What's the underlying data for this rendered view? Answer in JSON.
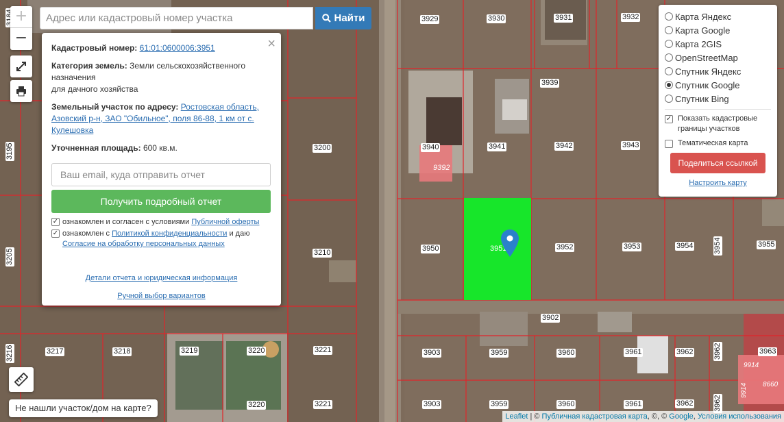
{
  "search": {
    "placeholder": "Адрес или кадастровый номер участка",
    "button_label": "Найти"
  },
  "zoom": {
    "in_label": "+",
    "out_label": "−"
  },
  "popup": {
    "cadastral_label": "Кадастровый номер:",
    "cadastral_number": "61:01:0600006:3951",
    "category_label": "Категория земель:",
    "category_value": "Земли сельскохозяйственного назначения",
    "category_value2": "для дачного хозяйства",
    "address_label": "Земельный участок по адресу:",
    "address_value": "Ростовская область, Азовский р-н, ЗАО \"Обильное\", поля 86-88, 1 км от с. Кулешовка",
    "area_label": "Уточненная площадь:",
    "area_value": "600 кв.м.",
    "email_placeholder": "Ваш email, куда отправить отчет",
    "report_button": "Получить подробный отчет",
    "agree1_text": "ознакомлен и согласен с условиями",
    "agree1_link": "Публичной оферты",
    "agree2_text": "ознакомлен с",
    "agree2_link": "Политикой конфиденциальности",
    "agree2_suffix": "и даю",
    "agree2_link2": "Согласие на обработку персональных данных",
    "details_link": "Детали отчета и юридическая информация",
    "manual_link": "Ручной выбор вариантов",
    "close_label": "×"
  },
  "layers": {
    "options": [
      {
        "label": "Карта Яндекс",
        "selected": false
      },
      {
        "label": "Карта Google",
        "selected": false
      },
      {
        "label": "Карта 2GIS",
        "selected": false
      },
      {
        "label": "OpenStreetMap",
        "selected": false
      },
      {
        "label": "Спутник Яндекс",
        "selected": false
      },
      {
        "label": "Спутник Google",
        "selected": true
      },
      {
        "label": "Спутник Bing",
        "selected": false
      }
    ],
    "show_borders_label": "Показать кадастровые границы участков",
    "show_borders_checked": true,
    "thematic_label": "Тематическая карта",
    "thematic_checked": false,
    "share_button": "Поделиться ссылкой",
    "setup_link": "Настроить карту"
  },
  "not_found_button": "Не нашли участок/дом на карте?",
  "attribution": {
    "leaflet": "Leaflet",
    "sep1": " | © ",
    "pkk": "Публичная кадастровая карта",
    "sep2": ", ©, © ",
    "google": "Google",
    "sep3": ", ",
    "terms": "Условия использования"
  },
  "parcels": [
    {
      "label": "3929"
    },
    {
      "label": "3930"
    },
    {
      "label": "3931"
    },
    {
      "label": "3932"
    },
    {
      "label": "3939"
    },
    {
      "label": "3940"
    },
    {
      "label": "3941"
    },
    {
      "label": "3942"
    },
    {
      "label": "3943"
    },
    {
      "label": "9392"
    },
    {
      "label": "3200"
    },
    {
      "label": "3195"
    },
    {
      "label": "3950"
    },
    {
      "label": "3951"
    },
    {
      "label": "3952"
    },
    {
      "label": "3953"
    },
    {
      "label": "3954"
    },
    {
      "label": "3954"
    },
    {
      "label": "3955"
    },
    {
      "label": "3210"
    },
    {
      "label": "3205"
    },
    {
      "label": "3902"
    },
    {
      "label": "3216"
    },
    {
      "label": "3217"
    },
    {
      "label": "3218"
    },
    {
      "label": "3219"
    },
    {
      "label": "3220"
    },
    {
      "label": "3221"
    },
    {
      "label": "3903"
    },
    {
      "label": "3959"
    },
    {
      "label": "3960"
    },
    {
      "label": "3961"
    },
    {
      "label": "3962"
    },
    {
      "label": "3962"
    },
    {
      "label": "3963"
    },
    {
      "label": "9914"
    },
    {
      "label": "8660"
    },
    {
      "label": "9914"
    },
    {
      "label": "3220"
    },
    {
      "label": "3221"
    },
    {
      "label": "3903"
    },
    {
      "label": "3959"
    },
    {
      "label": "3960"
    },
    {
      "label": "3961"
    },
    {
      "label": "3962"
    },
    {
      "label": "3962"
    },
    {
      "label": "3184"
    }
  ],
  "colors": {
    "selected_parcel": "#17e62a",
    "boundary": "#e0252b",
    "marker": "#2a81cb",
    "accent_button": "#337ab7",
    "report_button": "#5cb85c",
    "share_button": "#d9534f"
  }
}
